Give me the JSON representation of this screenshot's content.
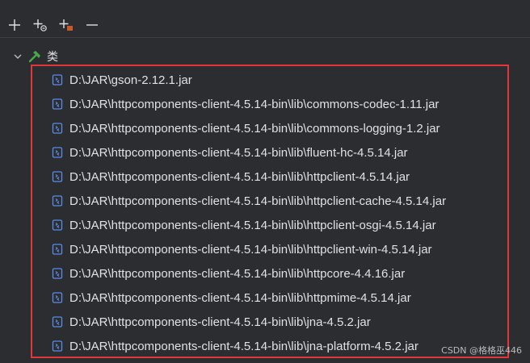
{
  "category": {
    "label": "类",
    "icon": "hammer-icon"
  },
  "toolbar": {
    "buttons": [
      "add-icon",
      "add-link-icon",
      "add-module-icon",
      "remove-icon"
    ]
  },
  "jars": [
    "D:\\JAR\\gson-2.12.1.jar",
    "D:\\JAR\\httpcomponents-client-4.5.14-bin\\lib\\commons-codec-1.11.jar",
    "D:\\JAR\\httpcomponents-client-4.5.14-bin\\lib\\commons-logging-1.2.jar",
    "D:\\JAR\\httpcomponents-client-4.5.14-bin\\lib\\fluent-hc-4.5.14.jar",
    "D:\\JAR\\httpcomponents-client-4.5.14-bin\\lib\\httpclient-4.5.14.jar",
    "D:\\JAR\\httpcomponents-client-4.5.14-bin\\lib\\httpclient-cache-4.5.14.jar",
    "D:\\JAR\\httpcomponents-client-4.5.14-bin\\lib\\httpclient-osgi-4.5.14.jar",
    "D:\\JAR\\httpcomponents-client-4.5.14-bin\\lib\\httpclient-win-4.5.14.jar",
    "D:\\JAR\\httpcomponents-client-4.5.14-bin\\lib\\httpcore-4.4.16.jar",
    "D:\\JAR\\httpcomponents-client-4.5.14-bin\\lib\\httpmime-4.5.14.jar",
    "D:\\JAR\\httpcomponents-client-4.5.14-bin\\lib\\jna-4.5.2.jar",
    "D:\\JAR\\httpcomponents-client-4.5.14-bin\\lib\\jna-platform-4.5.2.jar"
  ],
  "watermark": "CSDN @格格巫446",
  "colors": {
    "background": "#2b2d30",
    "highlight_border": "#e0383a",
    "jar_icon": "#5a8de8"
  }
}
